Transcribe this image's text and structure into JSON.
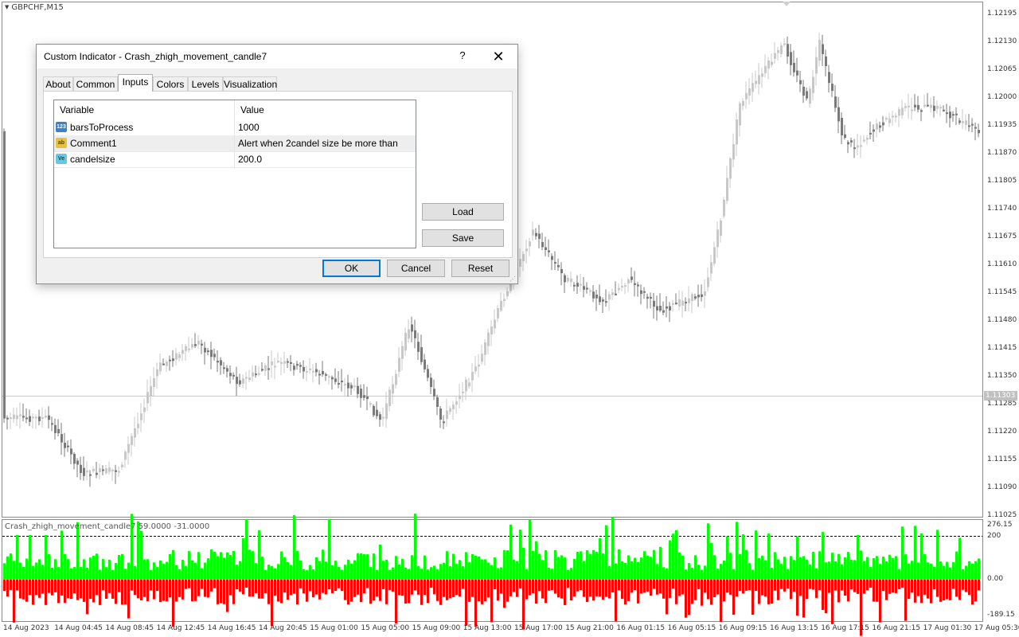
{
  "chart": {
    "symbol": "GBPCHF,M15",
    "indicator_label": "Crash_zhigh_movement_candle7 59.0000 -31.0000",
    "price_axis": [
      "1.12195",
      "1.12130",
      "1.12065",
      "1.12000",
      "1.11935",
      "1.11870",
      "1.11805",
      "1.11740",
      "1.11675",
      "1.11610",
      "1.11545",
      "1.11480",
      "1.11415",
      "1.11350",
      "1.11285",
      "1.11220",
      "1.11155",
      "1.11090",
      "1.11025"
    ],
    "current_price": "1.11303",
    "indicator_axis": [
      "276.15",
      "200",
      "0.00",
      "-189.15"
    ],
    "time_axis": [
      "14 Aug 2023",
      "14 Aug 04:45",
      "14 Aug 08:45",
      "14 Aug 12:45",
      "14 Aug 16:45",
      "14 Aug 20:45",
      "15 Aug 01:00",
      "15 Aug 05:00",
      "15 Aug 09:00",
      "15 Aug 13:00",
      "15 Aug 17:00",
      "15 Aug 21:00",
      "16 Aug 01:15",
      "16 Aug 05:15",
      "16 Aug 09:15",
      "16 Aug 13:15",
      "16 Aug 17:15",
      "16 Aug 21:15",
      "17 Aug 01:30",
      "17 Aug 05:30"
    ],
    "colors": {
      "bull": "#c8c8c8",
      "bear": "#7a7a7a",
      "pos_bar": "#00ff00",
      "neg_bar": "#ff0000"
    }
  },
  "dialog": {
    "title": "Custom Indicator - Crash_zhigh_movement_candle7",
    "help": "?",
    "close": "✕",
    "tabs": [
      "About",
      "Common",
      "Inputs",
      "Colors",
      "Levels",
      "Visualization"
    ],
    "active_tab": "Inputs",
    "columns": [
      "Variable",
      "Value"
    ],
    "rows": [
      {
        "icon": "123",
        "type": "int",
        "name": "barsToProcess",
        "value": "1000"
      },
      {
        "icon": "ab",
        "type": "str",
        "name": "Comment1",
        "value": "Alert when 2candel size be more than"
      },
      {
        "icon": "Ve",
        "type": "dbl",
        "name": "candelsize",
        "value": "200.0"
      }
    ],
    "load": "Load",
    "save": "Save",
    "ok": "OK",
    "cancel": "Cancel",
    "reset": "Reset"
  }
}
